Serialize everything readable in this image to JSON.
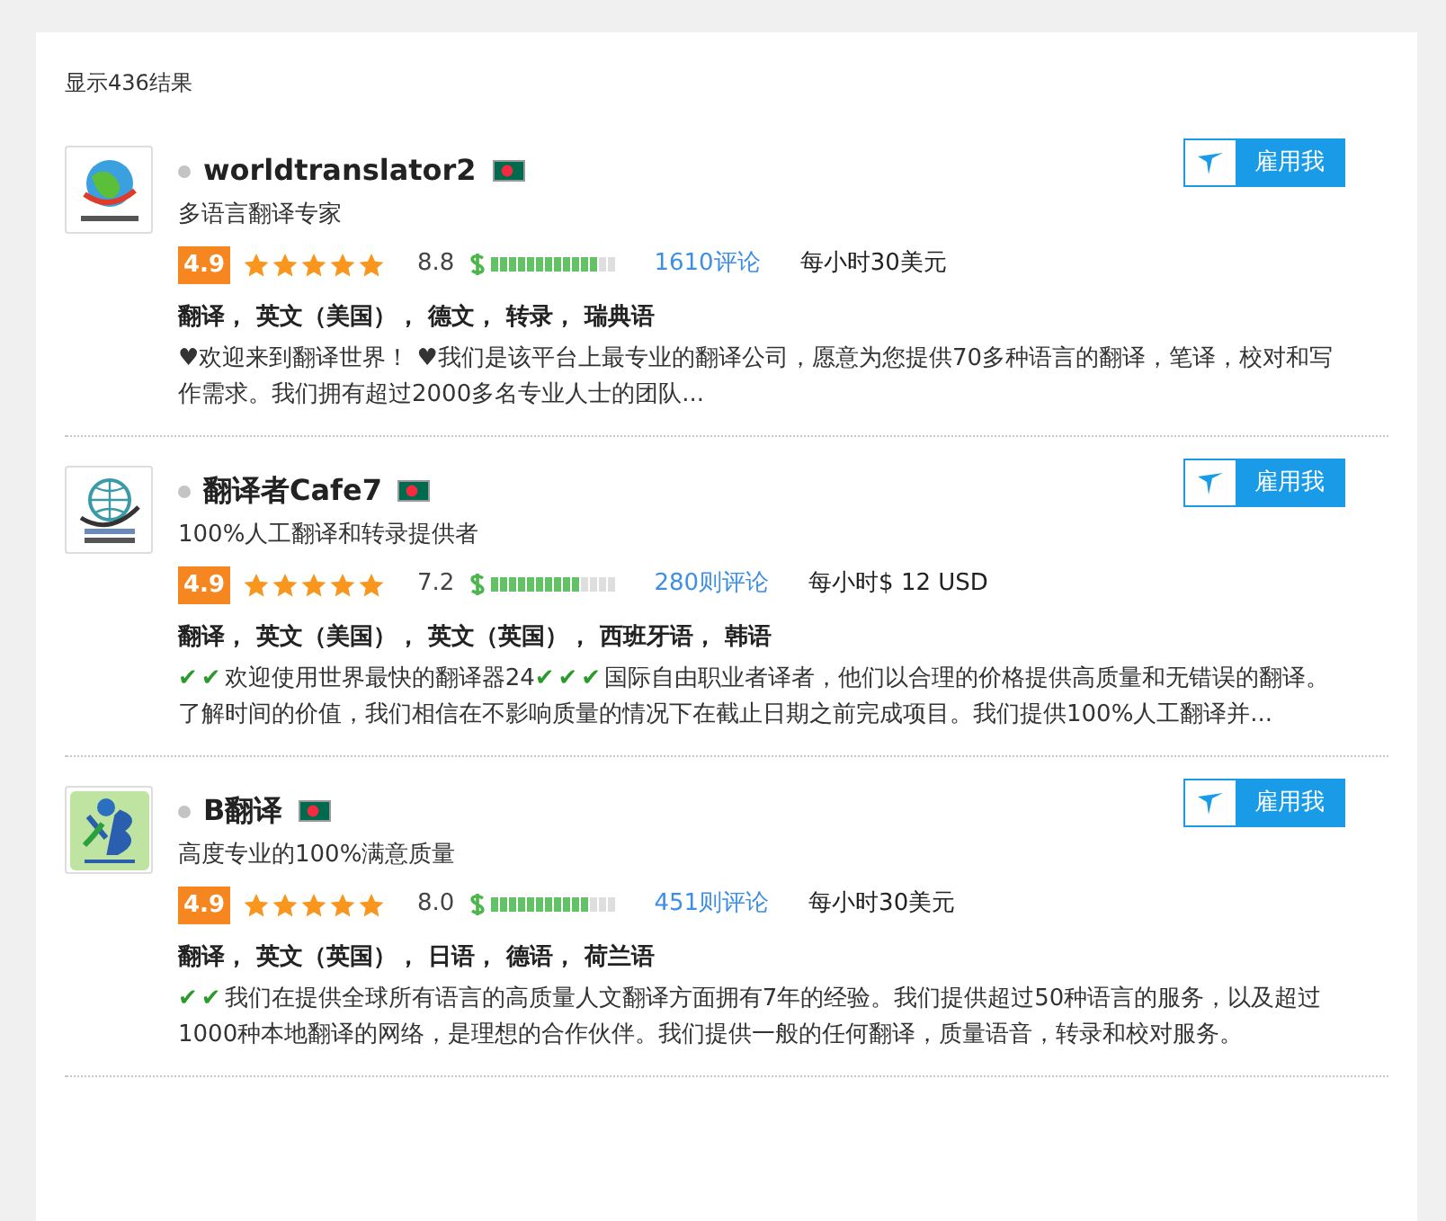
{
  "results_count": "显示436结果",
  "translators": [
    {
      "name": "worldtranslator2",
      "online": false,
      "headline": "多语言翻译专家",
      "rating": "4.9",
      "stars": 5,
      "price_score": "8.8",
      "level": 0.86,
      "reviews": "1610评论",
      "rate": "每小时30美元",
      "skills": "翻译， 英文（美国）， 德文， 转录， 瑞典语",
      "hire": "雇用我",
      "description": [
        {
          "kind": "text",
          "text": "♥欢迎来到翻译世界！ ♥我们是该平台上最专业的翻译公司，愿意为您提供70多种语言的翻译，笔译，校对和写作需求。我们拥有超过2000多名专业人士的团队..."
        }
      ]
    },
    {
      "name": "翻译者Cafe7",
      "online": false,
      "headline": "100%人工翻译和转录提供者",
      "rating": "4.9",
      "stars": 5,
      "price_score": "7.2",
      "level": 0.72,
      "reviews": "280则评论",
      "rate": "每小时$ 12 USD",
      "skills": "翻译， 英文（美国）， 英文（英国）， 西班牙语， 韩语",
      "hire": "雇用我",
      "description": [
        {
          "kind": "check",
          "text": "✔"
        },
        {
          "kind": "check",
          "text": "✔"
        },
        {
          "kind": "text",
          "text": "欢迎使用世界最快的翻译器24"
        },
        {
          "kind": "check",
          "text": "✔"
        },
        {
          "kind": "check",
          "text": "✔"
        },
        {
          "kind": "check",
          "text": "✔"
        },
        {
          "kind": "text",
          "text": "国际自由职业者译者，他们以合理的价格提供高质量和无错误的翻译。了解时间的价值，我们相信在不影响质量的情况下在截止日期之前完成项目。我们提供100%人工翻译并..."
        }
      ]
    },
    {
      "name": "B翻译",
      "online": false,
      "headline": "高度专业的100%满意质量",
      "rating": "4.9",
      "stars": 5,
      "price_score": "8.0",
      "level": 0.8,
      "reviews": "451则评论",
      "rate": "每小时30美元",
      "skills": "翻译， 英文（英国）， 日语， 德语， 荷兰语",
      "hire": "雇用我",
      "description": [
        {
          "kind": "check",
          "text": "✔"
        },
        {
          "kind": "check",
          "text": "✔"
        },
        {
          "kind": "text",
          "text": "我们在提供全球所有语言的高质量人文翻译方面拥有7年的经验。我们提供超过50种语言的服务，以及超过1000种本地翻译的网络，是理想的合作伙伴。我们提供一般的任何翻译，质量语音，转录和校对服务。"
        }
      ]
    }
  ]
}
